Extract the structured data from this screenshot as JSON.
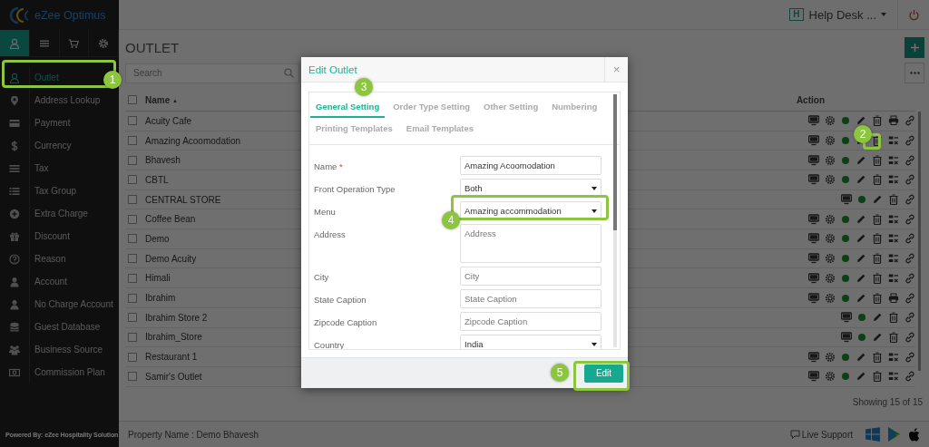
{
  "app": {
    "logo": "eZee Optimus",
    "helpdesk_badge": "H",
    "helpdesk": "Help Desk ...",
    "credit": "Powered By: eZee Hospitality Solution"
  },
  "sidebar": {
    "tabs": [
      {
        "selected": true
      },
      {
        "selected": false
      },
      {
        "selected": false
      },
      {
        "selected": false
      }
    ],
    "items": [
      {
        "label": "Outlet",
        "selected": true
      },
      {
        "label": "Address Lookup",
        "selected": false
      },
      {
        "label": "Payment",
        "selected": false
      },
      {
        "label": "Currency",
        "selected": false
      },
      {
        "label": "Tax",
        "selected": false
      },
      {
        "label": "Tax Group",
        "selected": false
      },
      {
        "label": "Extra Charge",
        "selected": false
      },
      {
        "label": "Discount",
        "selected": false
      },
      {
        "label": "Reason",
        "selected": false
      },
      {
        "label": "Account",
        "selected": false
      },
      {
        "label": "No Charge Account",
        "selected": false
      },
      {
        "label": "Guest Database",
        "selected": false
      },
      {
        "label": "Business Source",
        "selected": false
      },
      {
        "label": "Commission Plan",
        "selected": false
      }
    ]
  },
  "page": {
    "title": "OUTLET",
    "search_placeholder": "Search",
    "select_all_checked": false,
    "columns": [
      {
        "label": "Name",
        "sort_mark": "▲"
      },
      {
        "label": "Action"
      }
    ],
    "rows": [
      {
        "name": "Acuity Cafe",
        "checked": false,
        "active": true,
        "kind": "printer"
      },
      {
        "name": "Amazing Acoomodation",
        "checked": false,
        "active": true,
        "kind": "form"
      },
      {
        "name": "Bhavesh",
        "checked": false,
        "active": true,
        "kind": "form"
      },
      {
        "name": "CBTL",
        "checked": false,
        "active": true,
        "kind": "form"
      },
      {
        "name": "CENTRAL STORE",
        "checked": false,
        "active": true,
        "kind": "short"
      },
      {
        "name": "Coffee Bean",
        "checked": false,
        "active": true,
        "kind": "form"
      },
      {
        "name": "Demo",
        "checked": false,
        "active": true,
        "kind": "form"
      },
      {
        "name": "Demo Acuity",
        "checked": false,
        "active": true,
        "kind": "form"
      },
      {
        "name": "Himali",
        "checked": false,
        "active": true,
        "kind": "form"
      },
      {
        "name": "Ibrahim",
        "checked": false,
        "active": true,
        "kind": "printer"
      },
      {
        "name": "Ibrahim Store 2",
        "checked": false,
        "active": true,
        "kind": "short"
      },
      {
        "name": "Ibrahim_Store",
        "checked": false,
        "active": true,
        "kind": "short"
      },
      {
        "name": "Restaurant 1",
        "checked": false,
        "active": true,
        "kind": "form"
      },
      {
        "name": "Samir's Outlet",
        "checked": false,
        "active": true,
        "kind": "form"
      }
    ],
    "status": "Showing 15 of 15"
  },
  "footer": {
    "property": "Property Name : Demo Bhavesh",
    "support": "Live Support"
  },
  "modal": {
    "title": "Edit Outlet",
    "close": "×",
    "tabs": [
      {
        "label": "General Setting",
        "selected": true
      },
      {
        "label": "Order Type Setting",
        "selected": false
      },
      {
        "label": "Other Setting",
        "selected": false
      },
      {
        "label": "Numbering",
        "selected": false
      },
      {
        "label": "Printing Templates",
        "selected": false
      },
      {
        "label": "Email Templates",
        "selected": false
      }
    ],
    "fields": [
      {
        "kind": "text",
        "label": "Name",
        "required_mark": "*",
        "value": "Amazing Acoomodation"
      },
      {
        "kind": "select",
        "label": "Front Operation Type",
        "value": "Both"
      },
      {
        "kind": "select",
        "label": "Menu",
        "value": "Amazing accommodation"
      },
      {
        "kind": "textarea",
        "label": "Address",
        "placeholder": "Address"
      },
      {
        "kind": "text",
        "label": "City",
        "placeholder": "City"
      },
      {
        "kind": "text",
        "label": "State Caption",
        "placeholder": "State Caption"
      },
      {
        "kind": "text",
        "label": "Zipcode Caption",
        "placeholder": "Zipcode Caption"
      },
      {
        "kind": "select",
        "label": "Country",
        "value": "India"
      }
    ],
    "submit": "Edit"
  },
  "callouts": [
    {
      "label": "1"
    },
    {
      "label": "2"
    },
    {
      "label": "3"
    },
    {
      "label": "4"
    },
    {
      "label": "5"
    }
  ]
}
